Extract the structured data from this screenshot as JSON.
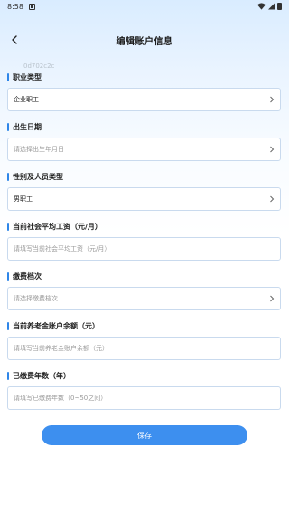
{
  "status": {
    "time": "8:58"
  },
  "header": {
    "title": "编辑账户信息"
  },
  "watermark": "0d702c2c",
  "form": {
    "occupation_type": {
      "label": "职业类型",
      "value": "企业职工",
      "placeholder": ""
    },
    "birth_date": {
      "label": "出生日期",
      "value": "",
      "placeholder": "请选择出生年月日"
    },
    "gender_type": {
      "label": "性别及人员类型",
      "value": "男职工",
      "placeholder": ""
    },
    "avg_salary": {
      "label": "当前社会平均工资（元/月）",
      "value": "",
      "placeholder": "请填写当前社会平均工资（元/月）"
    },
    "contribution_level": {
      "label": "缴费档次",
      "value": "",
      "placeholder": "请选择缴费档次"
    },
    "pension_balance": {
      "label": "当前养老金账户余额（元）",
      "value": "",
      "placeholder": "请填写当前养老金账户余额（元）"
    },
    "years_paid": {
      "label": "已缴费年数（年）",
      "value": "",
      "placeholder": "请填写已缴费年数（0~50之间）"
    }
  },
  "actions": {
    "save_label": "保存"
  },
  "colors": {
    "accent": "#3d8fef",
    "label_bar": "#2f86e8"
  },
  "icons": {
    "back": "chevron-left-icon",
    "select": "chevron-right-icon"
  }
}
